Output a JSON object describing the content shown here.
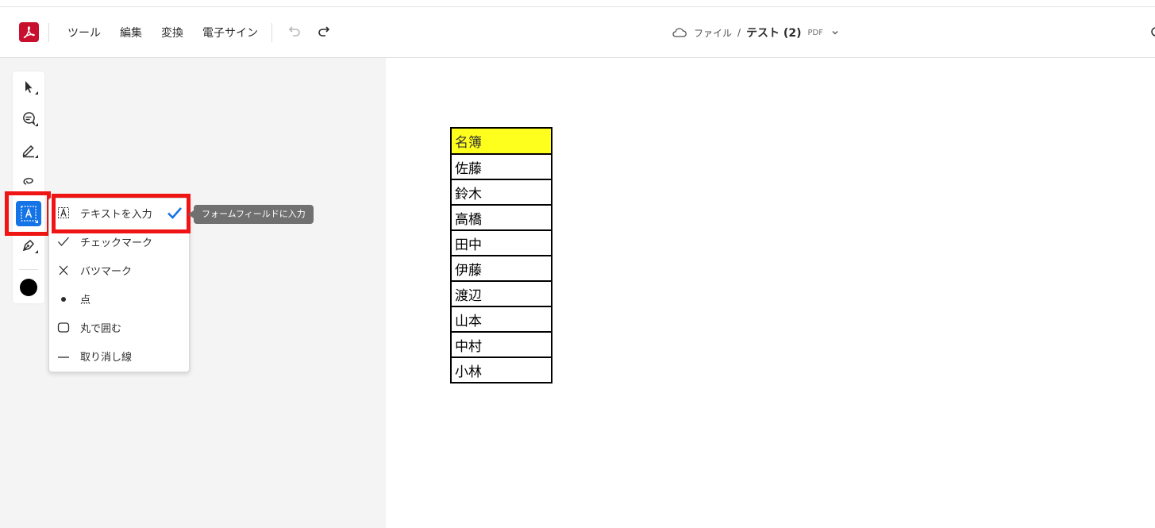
{
  "header": {
    "menu": [
      "ツール",
      "編集",
      "変換",
      "電子サイン"
    ],
    "breadcrumb": {
      "folder": "ファイル",
      "separator": "/",
      "title": "テスト (2)",
      "ext": "PDF"
    }
  },
  "toolbar": {
    "tools": [
      {
        "name": "select-tool",
        "icon": "pointer-arrow-icon"
      },
      {
        "name": "comment-tool",
        "icon": "speech-bubble-icon"
      },
      {
        "name": "highlight-tool",
        "icon": "pen-icon"
      },
      {
        "name": "draw-tool",
        "icon": "lasso-icon"
      },
      {
        "name": "text-input-tool",
        "icon": "text-box-icon",
        "active": true
      },
      {
        "name": "sign-tool",
        "icon": "pen-nib-icon"
      }
    ],
    "color": "#000000"
  },
  "fill_menu": {
    "items": [
      {
        "label": "テキストを入力",
        "icon": "text-box-icon",
        "selected": true
      },
      {
        "label": "チェックマーク",
        "icon": "checkmark-icon"
      },
      {
        "label": "バツマーク",
        "icon": "x-mark-icon"
      },
      {
        "label": "点",
        "icon": "dot-icon"
      },
      {
        "label": "丸で囲む",
        "icon": "rounded-rect-icon"
      },
      {
        "label": "取り消し線",
        "icon": "strikethrough-line-icon"
      }
    ]
  },
  "tooltip": {
    "text": "フォームフィールドに入力"
  },
  "document": {
    "table": {
      "header": "名簿",
      "header_color": "#ffff1e",
      "rows": [
        "佐藤",
        "鈴木",
        "高橋",
        "田中",
        "伊藤",
        "渡辺",
        "山本",
        "中村",
        "小林"
      ]
    }
  },
  "colors": {
    "accent": "#1473e6",
    "brand": "#c8102e",
    "highlight_box": "#f01515"
  }
}
